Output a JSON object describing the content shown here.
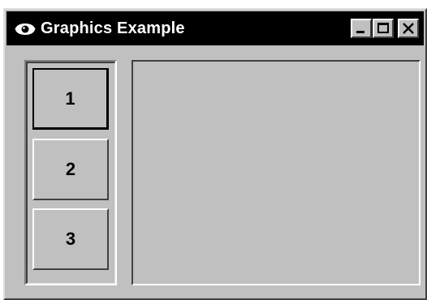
{
  "window": {
    "title": "Graphics Example",
    "app_icon": "eye-icon",
    "controls": {
      "minimize_icon": "minimize-icon",
      "maximize_icon": "maximize-icon",
      "close_icon": "close-icon"
    },
    "colors": {
      "titlebar": "#000000",
      "title_text": "#ffffff",
      "face": "#c0c0c0"
    }
  },
  "buttons": [
    {
      "label": "1",
      "focused": true
    },
    {
      "label": "2",
      "focused": false
    },
    {
      "label": "3",
      "focused": false
    }
  ]
}
